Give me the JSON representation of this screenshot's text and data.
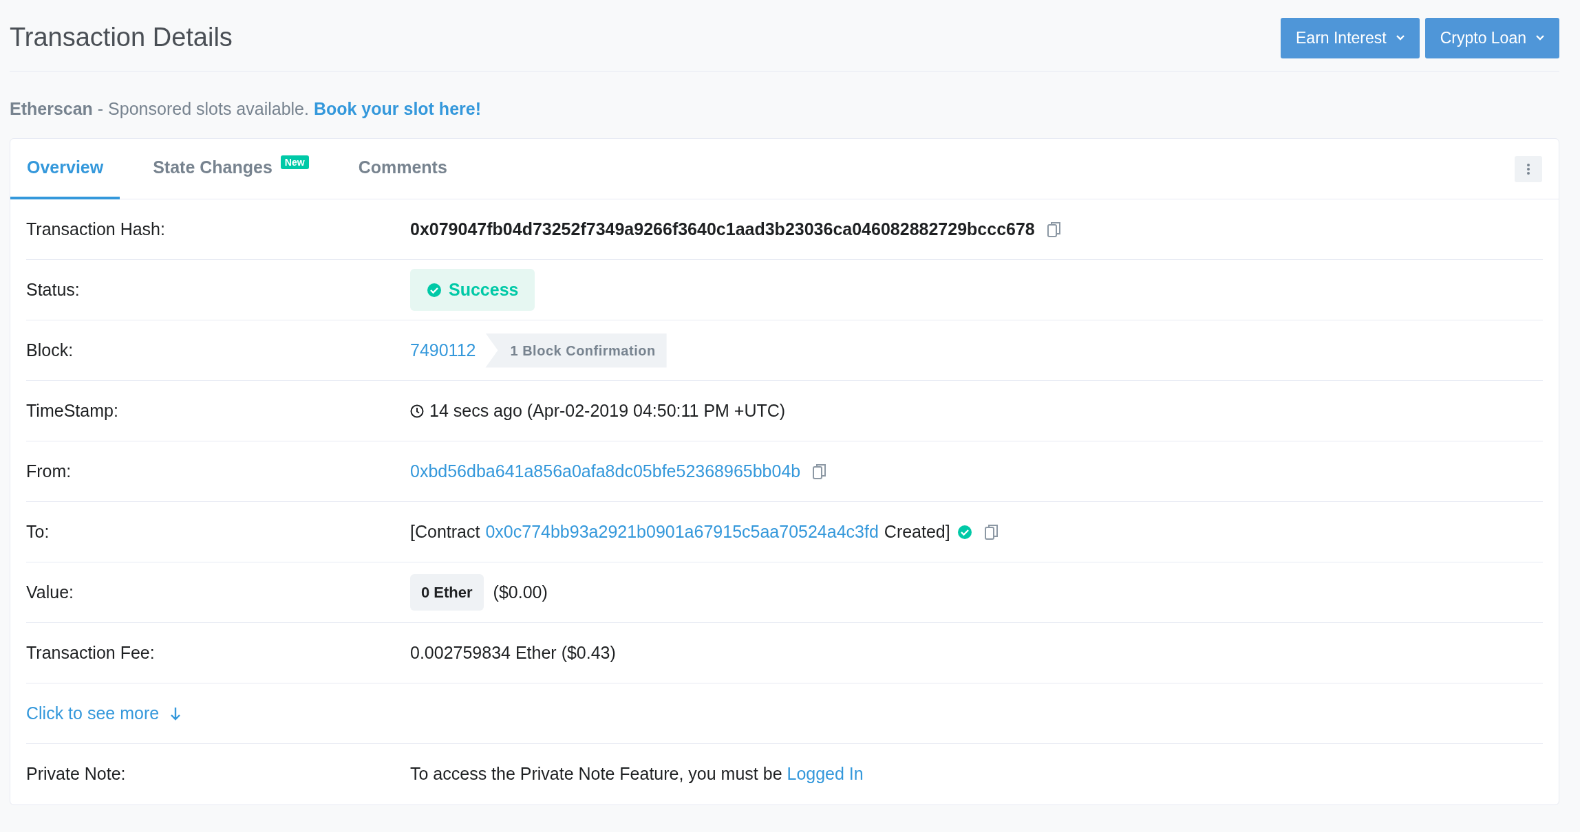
{
  "header": {
    "title": "Transaction Details",
    "buttons": [
      {
        "label": "Earn Interest"
      },
      {
        "label": "Crypto Loan"
      }
    ]
  },
  "sponsor": {
    "brand": "Etherscan",
    "text": "- Sponsored slots available.",
    "link": "Book your slot here!"
  },
  "tabs": [
    {
      "label": "Overview",
      "selected": true
    },
    {
      "label": "State Changes",
      "selected": false,
      "badge": "New"
    },
    {
      "label": "Comments",
      "selected": false
    }
  ],
  "rows": [
    {
      "kind": "hash",
      "label": "Transaction Hash:",
      "value": "0x079047fb04d73252f7349a9266f3640c1aad3b23036ca046082882729bccc678"
    },
    {
      "kind": "status",
      "label": "Status:",
      "value": "Success"
    },
    {
      "kind": "block",
      "label": "Block:",
      "link": "7490112",
      "confirmations": "1 Block Confirmation"
    },
    {
      "kind": "timestamp",
      "label": "TimeStamp:",
      "value": "14 secs ago (Apr-02-2019 04:50:11 PM +UTC)"
    },
    {
      "kind": "address",
      "label": "From:",
      "link": "0xbd56dba641a856a0afa8dc05bfe52368965bb04b"
    },
    {
      "kind": "contract",
      "label": "To:",
      "prefix": "[Contract",
      "link": "0x0c774bb93a2921b0901a67915c5aa70524a4c3fd",
      "suffix": "Created]"
    },
    {
      "kind": "value",
      "label": "Value:",
      "amount": "0 Ether",
      "usd": "($0.00)"
    },
    {
      "kind": "text",
      "label": "Transaction Fee:",
      "value": "0.002759834 Ether ($0.43)"
    },
    {
      "kind": "more",
      "link": "Click to see more"
    },
    {
      "kind": "note",
      "label": "Private Note:",
      "text": "To access the Private Note Feature, you must be",
      "link": "Logged In"
    }
  ]
}
